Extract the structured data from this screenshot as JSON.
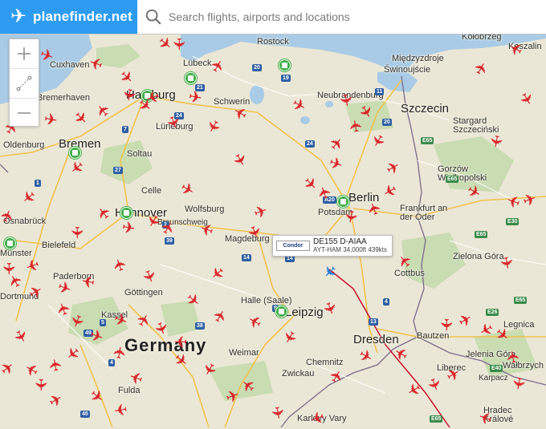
{
  "header": {
    "brand_name": "planefinder.net",
    "search_placeholder": "Search flights, airports and locations"
  },
  "map_controls": {
    "zoom_in_label": "+",
    "measure_label": "measure",
    "zoom_out_label": "−"
  },
  "selected_flight": {
    "airline_logo_text": "Condor",
    "callsign_reg": "DE155 D-AIAA",
    "route_info": "AYT-HAM 34,000ft 439kts",
    "track_color": "#c8102e"
  },
  "map": {
    "country_label": "Germany",
    "cities": [
      {
        "name": "Rostock"
      },
      {
        "name": "Kołobrzeg"
      },
      {
        "name": "Koszalin"
      },
      {
        "name": "Cuxhaven"
      },
      {
        "name": "Lübeck"
      },
      {
        "name": "Międzyzdroje"
      },
      {
        "name": "Świnoujście"
      },
      {
        "name": "Bremerhaven"
      },
      {
        "name": "Hamburg"
      },
      {
        "name": "Schwerin"
      },
      {
        "name": "Neubrandenburg"
      },
      {
        "name": "Szczecin"
      },
      {
        "name": "Stargard Szczeciński"
      },
      {
        "name": "Oldenburg"
      },
      {
        "name": "Lüneburg"
      },
      {
        "name": "Bremen"
      },
      {
        "name": "Soltau"
      },
      {
        "name": "Gorzów Wielkopolski"
      },
      {
        "name": "Celle"
      },
      {
        "name": "Berlin"
      },
      {
        "name": "Osnabrück"
      },
      {
        "name": "Hannover"
      },
      {
        "name": "Wolfsburg"
      },
      {
        "name": "Potsdam"
      },
      {
        "name": "Frankfurt an der Oder"
      },
      {
        "name": "Braunschweig"
      },
      {
        "name": "Magdeburg"
      },
      {
        "name": "Bielefeld"
      },
      {
        "name": "Münster"
      },
      {
        "name": "Zielona Góra"
      },
      {
        "name": "Paderborn"
      },
      {
        "name": "Cottbus"
      },
      {
        "name": "Göttingen"
      },
      {
        "name": "Dortmund"
      },
      {
        "name": "Halle (Saale)"
      },
      {
        "name": "Leipzig"
      },
      {
        "name": "Kassel"
      },
      {
        "name": "Legnica"
      },
      {
        "name": "Bautzen"
      },
      {
        "name": "Dresden"
      },
      {
        "name": "Jelenia Góra"
      },
      {
        "name": "Wałbrzych"
      },
      {
        "name": "Weimar"
      },
      {
        "name": "Chemnitz"
      },
      {
        "name": "Liberec"
      },
      {
        "name": "Karpacz"
      },
      {
        "name": "Fulda"
      },
      {
        "name": "Zwickau"
      },
      {
        "name": "Karlovy Vary"
      },
      {
        "name": "Hradec Králové"
      }
    ],
    "road_badges": [
      "20",
      "19",
      "11",
      "24",
      "20",
      "21",
      "24",
      "7",
      "27",
      "2",
      "39",
      "14",
      "9",
      "14",
      "13",
      "4",
      "49",
      "38",
      "5",
      "4",
      "45",
      "E65",
      "E65",
      "E30",
      "E65",
      "E65",
      "E65",
      "E26",
      "E40",
      "1",
      "A20"
    ]
  },
  "colors": {
    "brand": "#2d9cf0",
    "plane": "#d8262c",
    "selected_plane": "#2a7fd4",
    "airport": "#3fae48",
    "land": "#ebe7d6",
    "water": "#a9cbe6",
    "forest": "#c9dcb2"
  }
}
